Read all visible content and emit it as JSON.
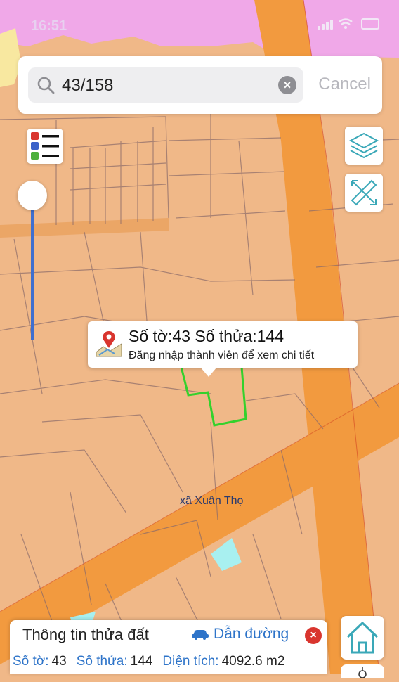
{
  "status_bar": {
    "time": "16:51"
  },
  "search": {
    "query": "43/158",
    "cancel_label": "Cancel"
  },
  "popup": {
    "title": "Số tờ:43 Số thửa:144",
    "subtitle": "Đăng nhập thành viên để xem chi tiết"
  },
  "map": {
    "place_label": "xã Xuân Thọ",
    "colors": {
      "residential": "#f0b888",
      "road": "#f29a3f",
      "urban": "#f0a8e8",
      "selected_parcel_outline": "#34d12c",
      "water_patch": "#a8f0f0",
      "parcel_lines": "#8a6a6a"
    }
  },
  "info_panel": {
    "title": "Thông tin thửa đất",
    "directions_label": "Dẫn đường",
    "fields": [
      {
        "label": "Số tờ:",
        "value": "43"
      },
      {
        "label": "Số thửa:",
        "value": "144"
      },
      {
        "label": "Diện tích:",
        "value": "4092.6 m2"
      }
    ]
  },
  "icons": {
    "search": "search-icon",
    "clear": "clear-icon",
    "legend": "legend-list-icon",
    "layers": "layers-icon",
    "measure": "ruler-measure-icon",
    "map_pin": "map-pin-icon",
    "car": "car-icon",
    "close": "close-icon",
    "home": "home-icon",
    "gps": "gps-icon"
  }
}
